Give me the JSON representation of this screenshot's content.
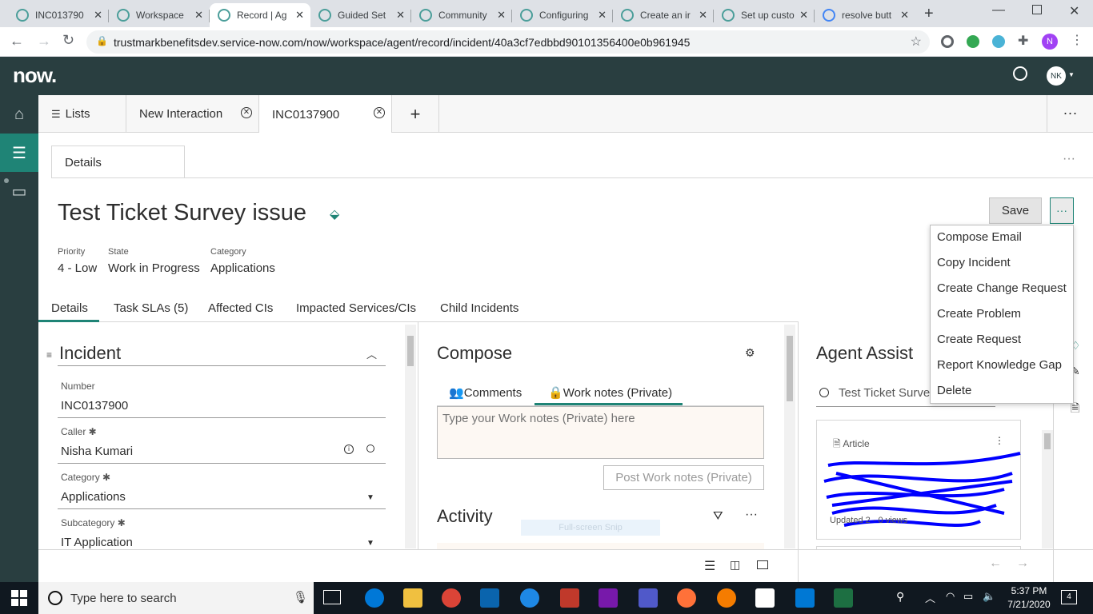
{
  "browser": {
    "tabs": [
      {
        "title": "INC013790",
        "active": false
      },
      {
        "title": "Workspace",
        "active": false
      },
      {
        "title": "Record | Ag",
        "active": true
      },
      {
        "title": "Guided Set",
        "active": false
      },
      {
        "title": "Community",
        "active": false
      },
      {
        "title": "Configuring",
        "active": false
      },
      {
        "title": "Create an ir",
        "active": false
      },
      {
        "title": "Set up custo",
        "active": false
      },
      {
        "title": "resolve butt",
        "active": false
      }
    ],
    "url": "trustmarkbenefitsdev.service-now.com/now/workspace/agent/record/incident/40a3cf7edbbd90101356400e0b961945",
    "profile_initial": "N"
  },
  "app": {
    "logo": "now.",
    "user_initials": "NK"
  },
  "workspace_tabs": {
    "lists": "Lists",
    "new_interaction": "New Interaction",
    "current": "INC0137900"
  },
  "record": {
    "subtab": "Details",
    "title": "Test Ticket Survey issue",
    "save_label": "Save",
    "header_fields": [
      {
        "label": "Priority",
        "value": "4 - Low"
      },
      {
        "label": "State",
        "value": "Work in Progress"
      },
      {
        "label": "Category",
        "value": "Applications"
      }
    ],
    "form_tabs": [
      "Details",
      "Task SLAs (5)",
      "Affected CIs",
      "Impacted Services/CIs",
      "Child Incidents"
    ]
  },
  "incident_form": {
    "section_title": "Incident",
    "fields": [
      {
        "label": "Number",
        "value": "INC0137900"
      },
      {
        "label": "Caller",
        "value": "Nisha Kumari"
      },
      {
        "label": "Category",
        "value": "Applications"
      },
      {
        "label": "Subcategory",
        "value": "IT Application"
      }
    ]
  },
  "compose": {
    "title": "Compose",
    "tab_comments": "Comments",
    "tab_worknotes": "Work notes (Private)",
    "placeholder": "Type your Work notes (Private) here",
    "post_label": "Post Work notes (Private)",
    "activity_title": "Activity",
    "snip_text": "Full-screen Snip"
  },
  "agent_assist": {
    "title": "Agent Assist",
    "search_value": "Test Ticket Surve",
    "card_type": "Article",
    "card_meta": "Updated 2 · 0 views"
  },
  "more_menu": {
    "items": [
      "Compose Email",
      "Copy Incident",
      "Create Change Request",
      "Create Problem",
      "Create Request",
      "Report Knowledge Gap",
      "Delete"
    ]
  },
  "taskbar": {
    "search_placeholder": "Type here to search",
    "time": "5:37 PM",
    "date": "7/21/2020",
    "notification_count": "4"
  },
  "colors": {
    "header": "#293e40",
    "accent": "#1f8476",
    "compose_bg": "#fdf8f3"
  }
}
